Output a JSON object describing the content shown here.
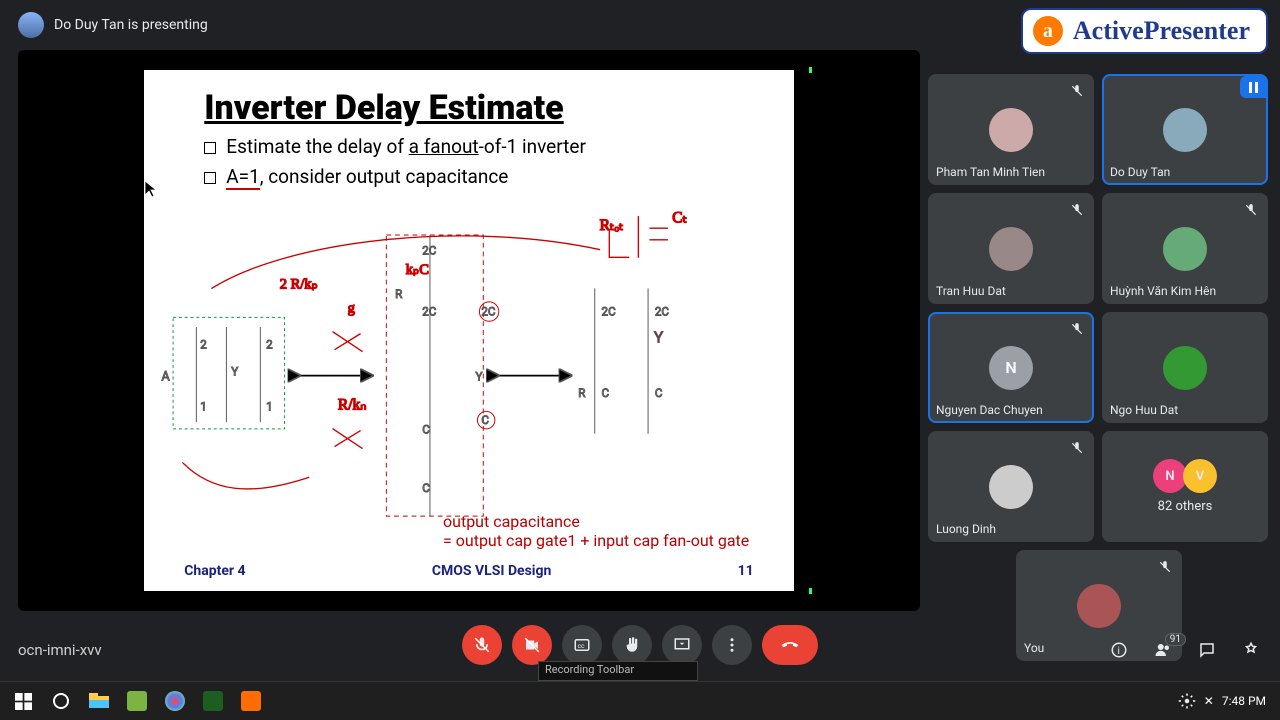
{
  "presenter_line": "Do Duy Tan is presenting",
  "watermark": "ActivePresenter",
  "slide": {
    "title": "Inverter Delay Estimate",
    "bullet1_prefix": "Estimate the delay of ",
    "bullet1_underlined": "a fanout",
    "bullet1_suffix": "-of-1 inverter",
    "bullet2_prefix": "A=1",
    "bullet2_suffix": ", consider output capacitance",
    "redcap_l1": "output capacitance",
    "redcap_l2": "= output cap gate1 + input cap fan-out gate",
    "footer_left": "Chapter 4",
    "footer_mid": "CMOS VLSI Design",
    "footer_page": "11"
  },
  "participants": [
    {
      "name": "Pham Tan Minh Tien",
      "mute": true,
      "speaking": false,
      "avatar": "photo",
      "bg": "#caa"
    },
    {
      "name": "Do Duy Tan",
      "mute": true,
      "speaking": true,
      "avatar": "photo",
      "bg": "#8ab"
    },
    {
      "name": "Tran Huu Dat",
      "mute": true,
      "speaking": false,
      "avatar": "photo",
      "bg": "#988"
    },
    {
      "name": "Huỳnh Văn Kim Hên",
      "mute": true,
      "speaking": false,
      "avatar": "photo",
      "bg": "#6a7"
    },
    {
      "name": "Nguyen Dac Chuyen",
      "mute": true,
      "speaking": true,
      "avatar": "letter",
      "letter": "N",
      "bg": "#9aa0a6"
    },
    {
      "name": "Ngo Huu Dat",
      "mute": false,
      "speaking": false,
      "avatar": "photo",
      "bg": "#393"
    },
    {
      "name": "Luong Dinh",
      "mute": true,
      "speaking": false,
      "avatar": "photo",
      "bg": "#ccc"
    },
    {
      "name": "__others__"
    },
    {
      "name": "You",
      "mute": true,
      "speaking": false,
      "avatar": "photo",
      "bg": "#a55"
    }
  ],
  "others": {
    "count_label": "82 others",
    "circles": [
      {
        "t": "N",
        "c": "#ec407a"
      },
      {
        "t": "V",
        "c": "#fbc02d"
      }
    ]
  },
  "people_badge": "91",
  "meeting_code": "ocn-imni-xvv",
  "recording_toolbar": "Recording Toolbar",
  "clock": "7:48 PM",
  "taskbar_icons": [
    "start",
    "cortana",
    "files",
    "sublime",
    "paint",
    "calc",
    "foxit"
  ]
}
